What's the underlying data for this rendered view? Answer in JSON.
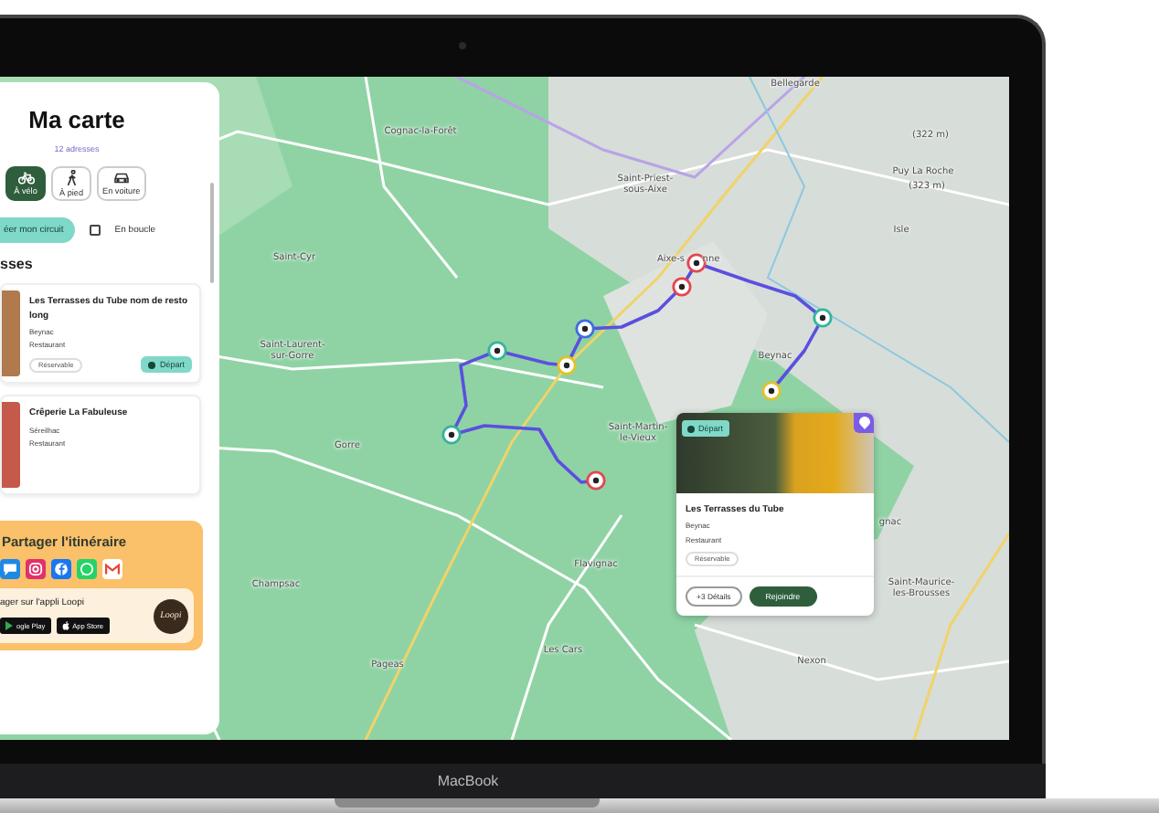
{
  "panel": {
    "title": "Ma carte",
    "count": "12 adresses",
    "modes": [
      {
        "kind": "bike",
        "label": "À vélo",
        "selected": true
      },
      {
        "kind": "walk",
        "label": "À pied",
        "selected": false
      },
      {
        "kind": "car",
        "label": "En voiture",
        "selected": false
      }
    ],
    "circuit_button": "éer mon circuit",
    "loop": {
      "label": "En boucle",
      "checked": false
    },
    "section_title": "sses",
    "places": [
      {
        "name": "Les Terrasses du Tube nom de resto long",
        "town": "Beynac",
        "type": "Restaurant",
        "tag": "Réservable",
        "action": "Départ"
      },
      {
        "name": "Crêperie La Fabuleuse",
        "town": "Séreilhac",
        "type": "Restaurant"
      }
    ],
    "share": {
      "title": "Partager l'itinéraire",
      "networks": [
        {
          "kind": "message"
        },
        {
          "kind": "instagram"
        },
        {
          "kind": "facebook"
        },
        {
          "kind": "whatsapp"
        },
        {
          "kind": "mail"
        }
      ],
      "app_text": "ager sur l'appli Loopi",
      "stores": [
        {
          "kind": "google",
          "name": "ogle Play"
        },
        {
          "kind": "apple",
          "name": "App Store"
        }
      ],
      "logo": "Loopi"
    }
  },
  "map": {
    "labels": [
      "Cognac-la-Forêt",
      "Saint-Priest-sous-Aixe",
      "Saint-Cyr",
      "Saint-Laurent-sur-Gorre",
      "Aixe-s",
      "nne",
      "Bellegarde",
      "(322 m)",
      "Puy La Roche",
      "(323 m)",
      "Isle",
      "Beynac",
      "Saint-Martin-le-Vieux",
      "Gorre",
      "Flavignac",
      "Champsac",
      "Pageas",
      "Les Cars",
      "Nexon",
      "gnac",
      "Saint-Maurice-les-Brousses"
    ]
  },
  "popup": {
    "badge": "Départ",
    "name": "Les Terrasses du Tube",
    "town": "Beynac",
    "type": "Restaurant",
    "tag": "Réservable",
    "details": "Détails",
    "details_count": "+3",
    "join": "Rejoindre"
  },
  "device": {
    "brand": "MacBook"
  }
}
